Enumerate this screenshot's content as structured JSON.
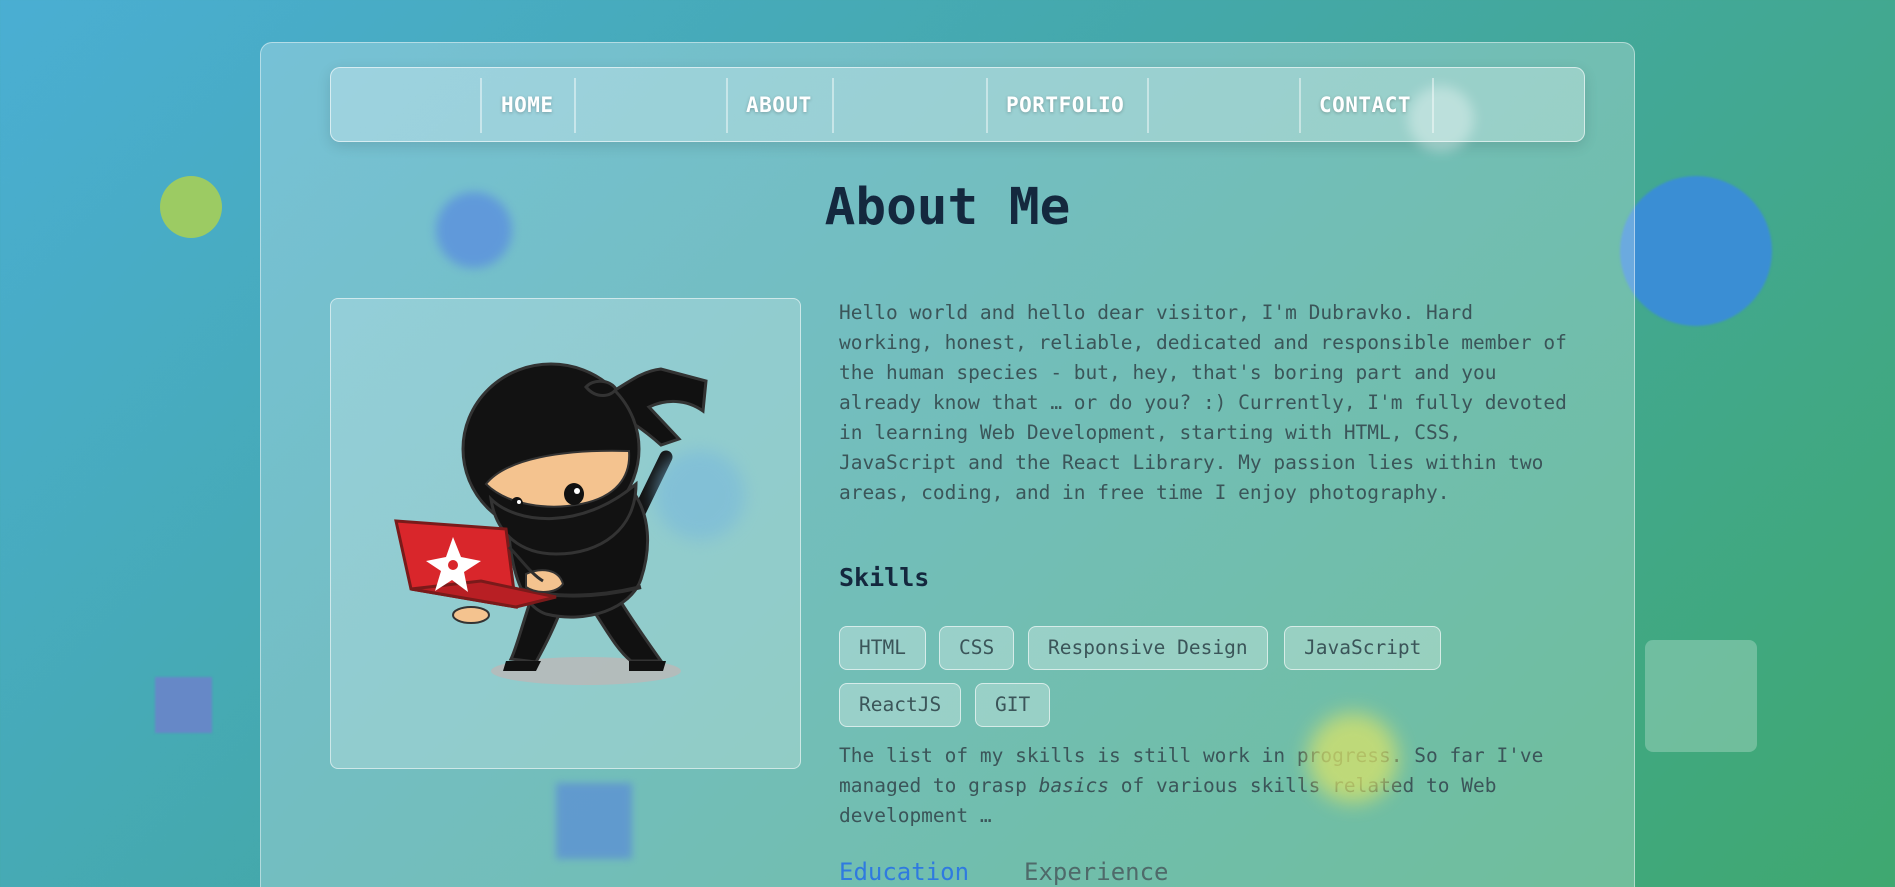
{
  "nav": {
    "items": [
      {
        "label": "HOME"
      },
      {
        "label": "ABOUT"
      },
      {
        "label": "PORTFOLIO"
      },
      {
        "label": "CONTACT"
      }
    ]
  },
  "about": {
    "title": "About Me",
    "bio": "Hello world and hello dear visitor, I'm Dubravko. Hard working, honest, reliable, dedicated and responsible member of the human species - but, hey, that's boring part and you already know that … or do you? :) Currently, I'm fully devoted in learning Web Development, starting with HTML, CSS, JavaScript and the React Library. My passion lies within two areas, coding, and in free time I enjoy photography.",
    "image_icon": "ninja-with-laptop-illustration"
  },
  "skills": {
    "heading": "Skills",
    "items": [
      "HTML",
      "CSS",
      "Responsive Design",
      "JavaScript",
      "ReactJS",
      "GIT"
    ],
    "note_before": "The list of my skills is still work in progress. So far I've managed to grasp ",
    "note_em": "basics",
    "note_after": " of various skills related to Web development …"
  },
  "tabs": {
    "education": "Education",
    "experience": "Experience"
  },
  "colors": {
    "accent": "#2f7ae0",
    "heading": "#14283e",
    "ninja_laptop": "#d9262b"
  }
}
